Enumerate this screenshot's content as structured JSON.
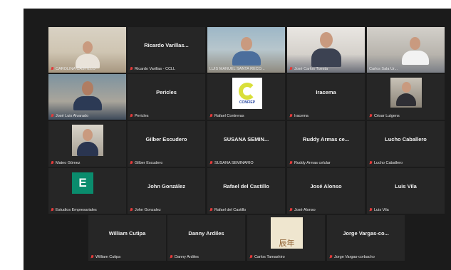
{
  "participants": [
    {
      "id": "p1",
      "label": "CAROLINA CASTILLO",
      "big_name": ""
    },
    {
      "id": "p2",
      "label": "Ricardo Varillas - CCLL",
      "big_name": "Ricardo Varillas..."
    },
    {
      "id": "p3",
      "label": "LUIS MANUEL SANTA RECO...",
      "big_name": ""
    },
    {
      "id": "p4",
      "label": "José Carlos Tuesta",
      "big_name": ""
    },
    {
      "id": "p5",
      "label": "Carlos Sala Ur...",
      "big_name": ""
    },
    {
      "id": "p6",
      "label": "José Luis Alvarado",
      "big_name": ""
    },
    {
      "id": "p7",
      "label": "Pericles",
      "big_name": "Pericles"
    },
    {
      "id": "p8",
      "label": "Rafael Contreras",
      "big_name": "",
      "logo_text": "CONFIEP"
    },
    {
      "id": "p9",
      "label": "Iracema",
      "big_name": "Iracema"
    },
    {
      "id": "p10",
      "label": "César Lutgens",
      "big_name": ""
    },
    {
      "id": "p11",
      "label": "Mateo Gómez",
      "big_name": ""
    },
    {
      "id": "p12",
      "label": "Gilber Escudero",
      "big_name": "Gilber Escudero"
    },
    {
      "id": "p13",
      "label": "SUSANA SEMINARIO",
      "big_name": "SUSANA SEMIN..."
    },
    {
      "id": "p14",
      "label": "Ruddy Armas celular",
      "big_name": "Ruddy Armas ce..."
    },
    {
      "id": "p15",
      "label": "Lucho Caballero",
      "big_name": "Lucho Caballero"
    },
    {
      "id": "p16",
      "label": "Estudios Empresariales",
      "big_name": "",
      "avatar_letter": "E"
    },
    {
      "id": "p17",
      "label": "John Gonzalez",
      "big_name": "John González"
    },
    {
      "id": "p18",
      "label": "Rafael del Castillo",
      "big_name": "Rafael del Castillo"
    },
    {
      "id": "p19",
      "label": "José Alonso",
      "big_name": "José Alonso"
    },
    {
      "id": "p20",
      "label": "Luis Vila",
      "big_name": "Luis Vila"
    },
    {
      "id": "p21",
      "label": "William Cutipa",
      "big_name": "William Cutipa"
    },
    {
      "id": "p22",
      "label": "Danny Ardiles",
      "big_name": "Danny Ardiles"
    },
    {
      "id": "p23",
      "label": "Carlos Tamashiro",
      "big_name": "",
      "art_glyph": "辰年"
    },
    {
      "id": "p24",
      "label": "Jorge Vargas-corbacho",
      "big_name": "Jorge Vargas-co..."
    }
  ],
  "colors": {
    "background": "#1b1b1b",
    "tile": "#262626",
    "active_speaker_border": "#d6e85c",
    "muted_mic": "#e23b3b"
  }
}
